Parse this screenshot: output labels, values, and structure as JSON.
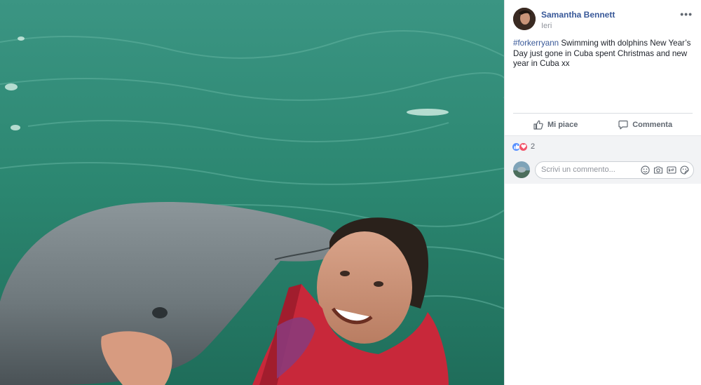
{
  "post": {
    "author": "Samantha Bennett",
    "time": "Ieri",
    "more_label": "•••",
    "hashtag": "#forkerryann",
    "text": " Swimming with dolphins New Year’s Day just gone in Cuba spent Christmas and new year in Cuba xx"
  },
  "actions": {
    "like_label": "Mi piace",
    "comment_label": "Commenta"
  },
  "reactions": {
    "count": "2",
    "types": [
      "like",
      "love"
    ]
  },
  "comment_box": {
    "placeholder": "Scrivi un commento...",
    "tools": [
      "emoji-icon",
      "camera-icon",
      "gif-icon",
      "sticker-icon"
    ]
  },
  "colors": {
    "link": "#385898",
    "like": "#5890ff",
    "love": "#f25268",
    "water": "#2f8a78"
  }
}
